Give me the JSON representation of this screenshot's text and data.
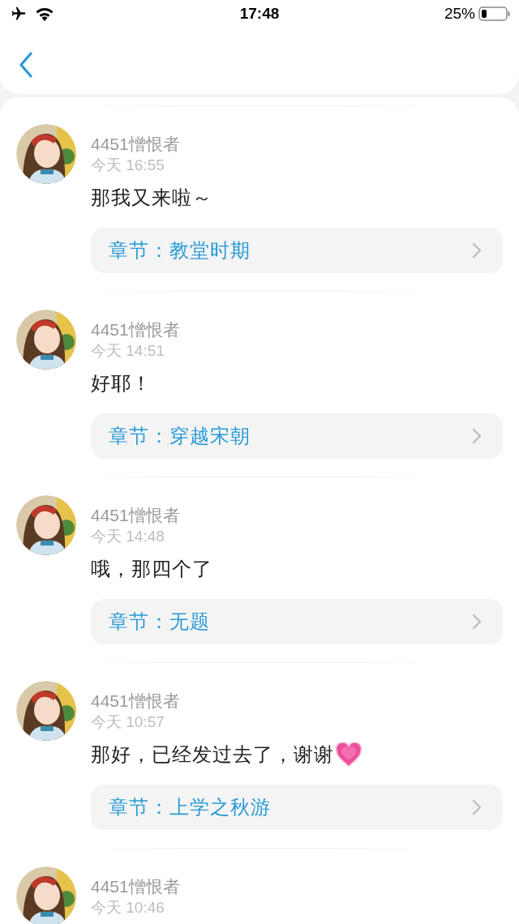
{
  "status_bar": {
    "time": "17:48",
    "battery": "25%"
  },
  "comments": [
    {
      "user": "4451憎恨者",
      "time": "今天 16:55",
      "message": "那我又来啦～",
      "chapter": "章节：教堂时期"
    },
    {
      "user": "4451憎恨者",
      "time": "今天 14:51",
      "message": "好耶！",
      "chapter": "章节：穿越宋朝"
    },
    {
      "user": "4451憎恨者",
      "time": "今天 14:48",
      "message": "哦，那四个了",
      "chapter": "章节：无题"
    },
    {
      "user": "4451憎恨者",
      "time": "今天 10:57",
      "message": "那好，已经发过去了，谢谢",
      "heart": true,
      "chapter": "章节：上学之秋游"
    },
    {
      "user": "4451憎恨者",
      "time": "今天 10:46"
    }
  ]
}
